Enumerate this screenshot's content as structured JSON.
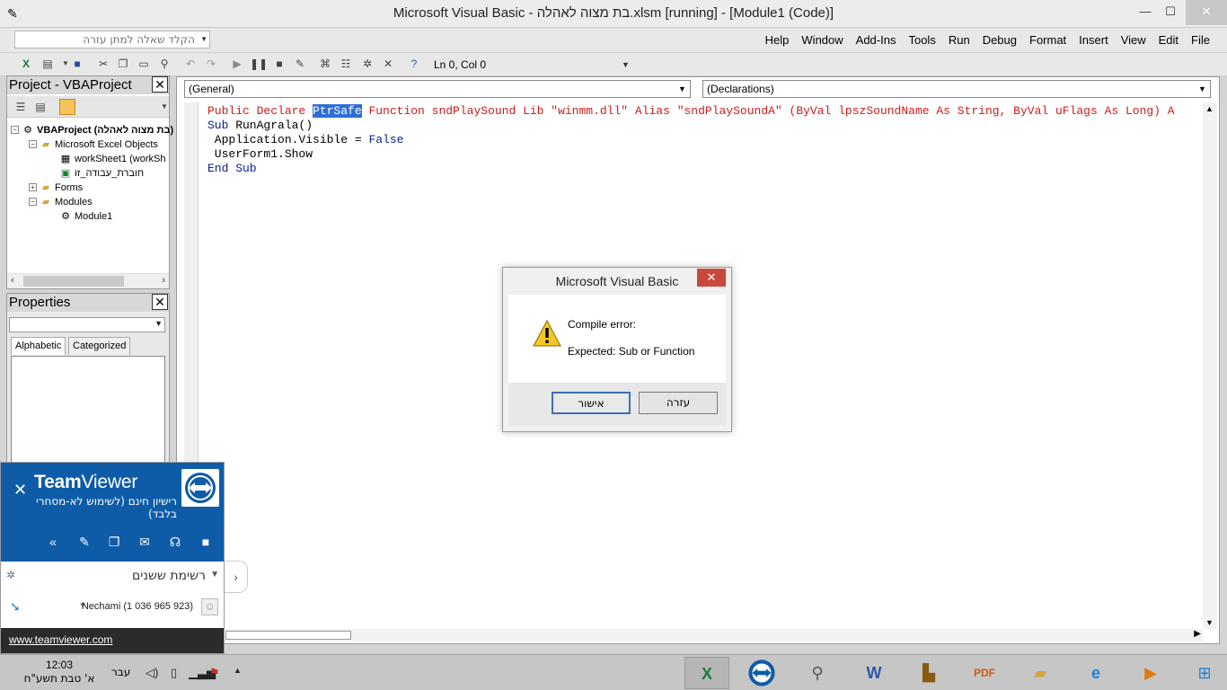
{
  "window": {
    "title": "Microsoft Visual Basic - בת מצוה לאהלה.xlsm [running] - [Module1 (Code)]",
    "controls": {
      "minimize": "—",
      "maximize": "☐",
      "close": "✕"
    }
  },
  "menubar": {
    "ask_placeholder": "הקלד שאלה למתן עזרה",
    "items": [
      "File",
      "Edit",
      "View",
      "Insert",
      "Format",
      "Debug",
      "Run",
      "Tools",
      "Add-Ins",
      "Window",
      "Help"
    ]
  },
  "toolbar": {
    "position_text": "Ln 0, Col 0",
    "icons": [
      "excel-icon",
      "insert-userform-icon",
      "save-icon",
      "cut-icon",
      "copy-icon",
      "paste-icon",
      "find-icon",
      "undo-icon",
      "redo-icon",
      "run-icon",
      "break-icon",
      "reset-icon",
      "design-mode-icon",
      "project-explorer-icon",
      "properties-icon",
      "object-browser-icon",
      "toolbox-icon",
      "help-icon"
    ]
  },
  "project": {
    "title": "Project - VBAProject",
    "tree": {
      "root": "VBAProject (בת מצוה לאהלה)",
      "excel_objects": "Microsoft Excel Objects",
      "sheet1": "workSheet1 (workSh",
      "workbook": "חוברת_עבודה_זו",
      "forms": "Forms",
      "modules": "Modules",
      "module1": "Module1"
    }
  },
  "properties": {
    "title": "Properties",
    "tab_alpha": "Alphabetic",
    "tab_cat": "Categorized"
  },
  "code": {
    "combo_object": "(General)",
    "combo_proc": "(Declarations)",
    "line1_pre": "Public Declare ",
    "line1_sel": "PtrSafe",
    "line1_post": " Function sndPlaySound Lib \"winmm.dll\" Alias \"sndPlaySoundA\" (ByVal lpszSoundName As String, ByVal uFlags As Long) A",
    "line2_kw": "Sub",
    "line2_rest": " RunAgrala()",
    "line3_pre": " Application.Visible = ",
    "line3_kw": "False",
    "line4": " UserForm1.Show",
    "line5_kw": "End Sub"
  },
  "dialog": {
    "title": "Microsoft Visual Basic",
    "line1": "Compile error:",
    "line2": "Expected: Sub or Function",
    "ok_label": "אישור",
    "help_label": "עזרה"
  },
  "teamviewer": {
    "brand_a": "Team",
    "brand_b": "Viewer",
    "license": "רישיון חינם (לשימוש לא-מסחרי בלבד)",
    "list_title": "רשימת ששנים",
    "partner": "Nechami (1 036 965 923)",
    "link": "www.teamviewer.com",
    "colors": {
      "header": "#0e5ca8",
      "footer": "#2b2b2b"
    }
  },
  "taskbar": {
    "time": "12:03",
    "date": "א' טבת תשע\"ח",
    "lang": "עבר",
    "apps": [
      "excel-icon",
      "teamviewer-icon",
      "magnifier-icon",
      "word-icon",
      "book-icon",
      "pdf-icon",
      "file-explorer-icon",
      "internet-explorer-icon",
      "media-icon",
      "start-tile-icon"
    ]
  }
}
